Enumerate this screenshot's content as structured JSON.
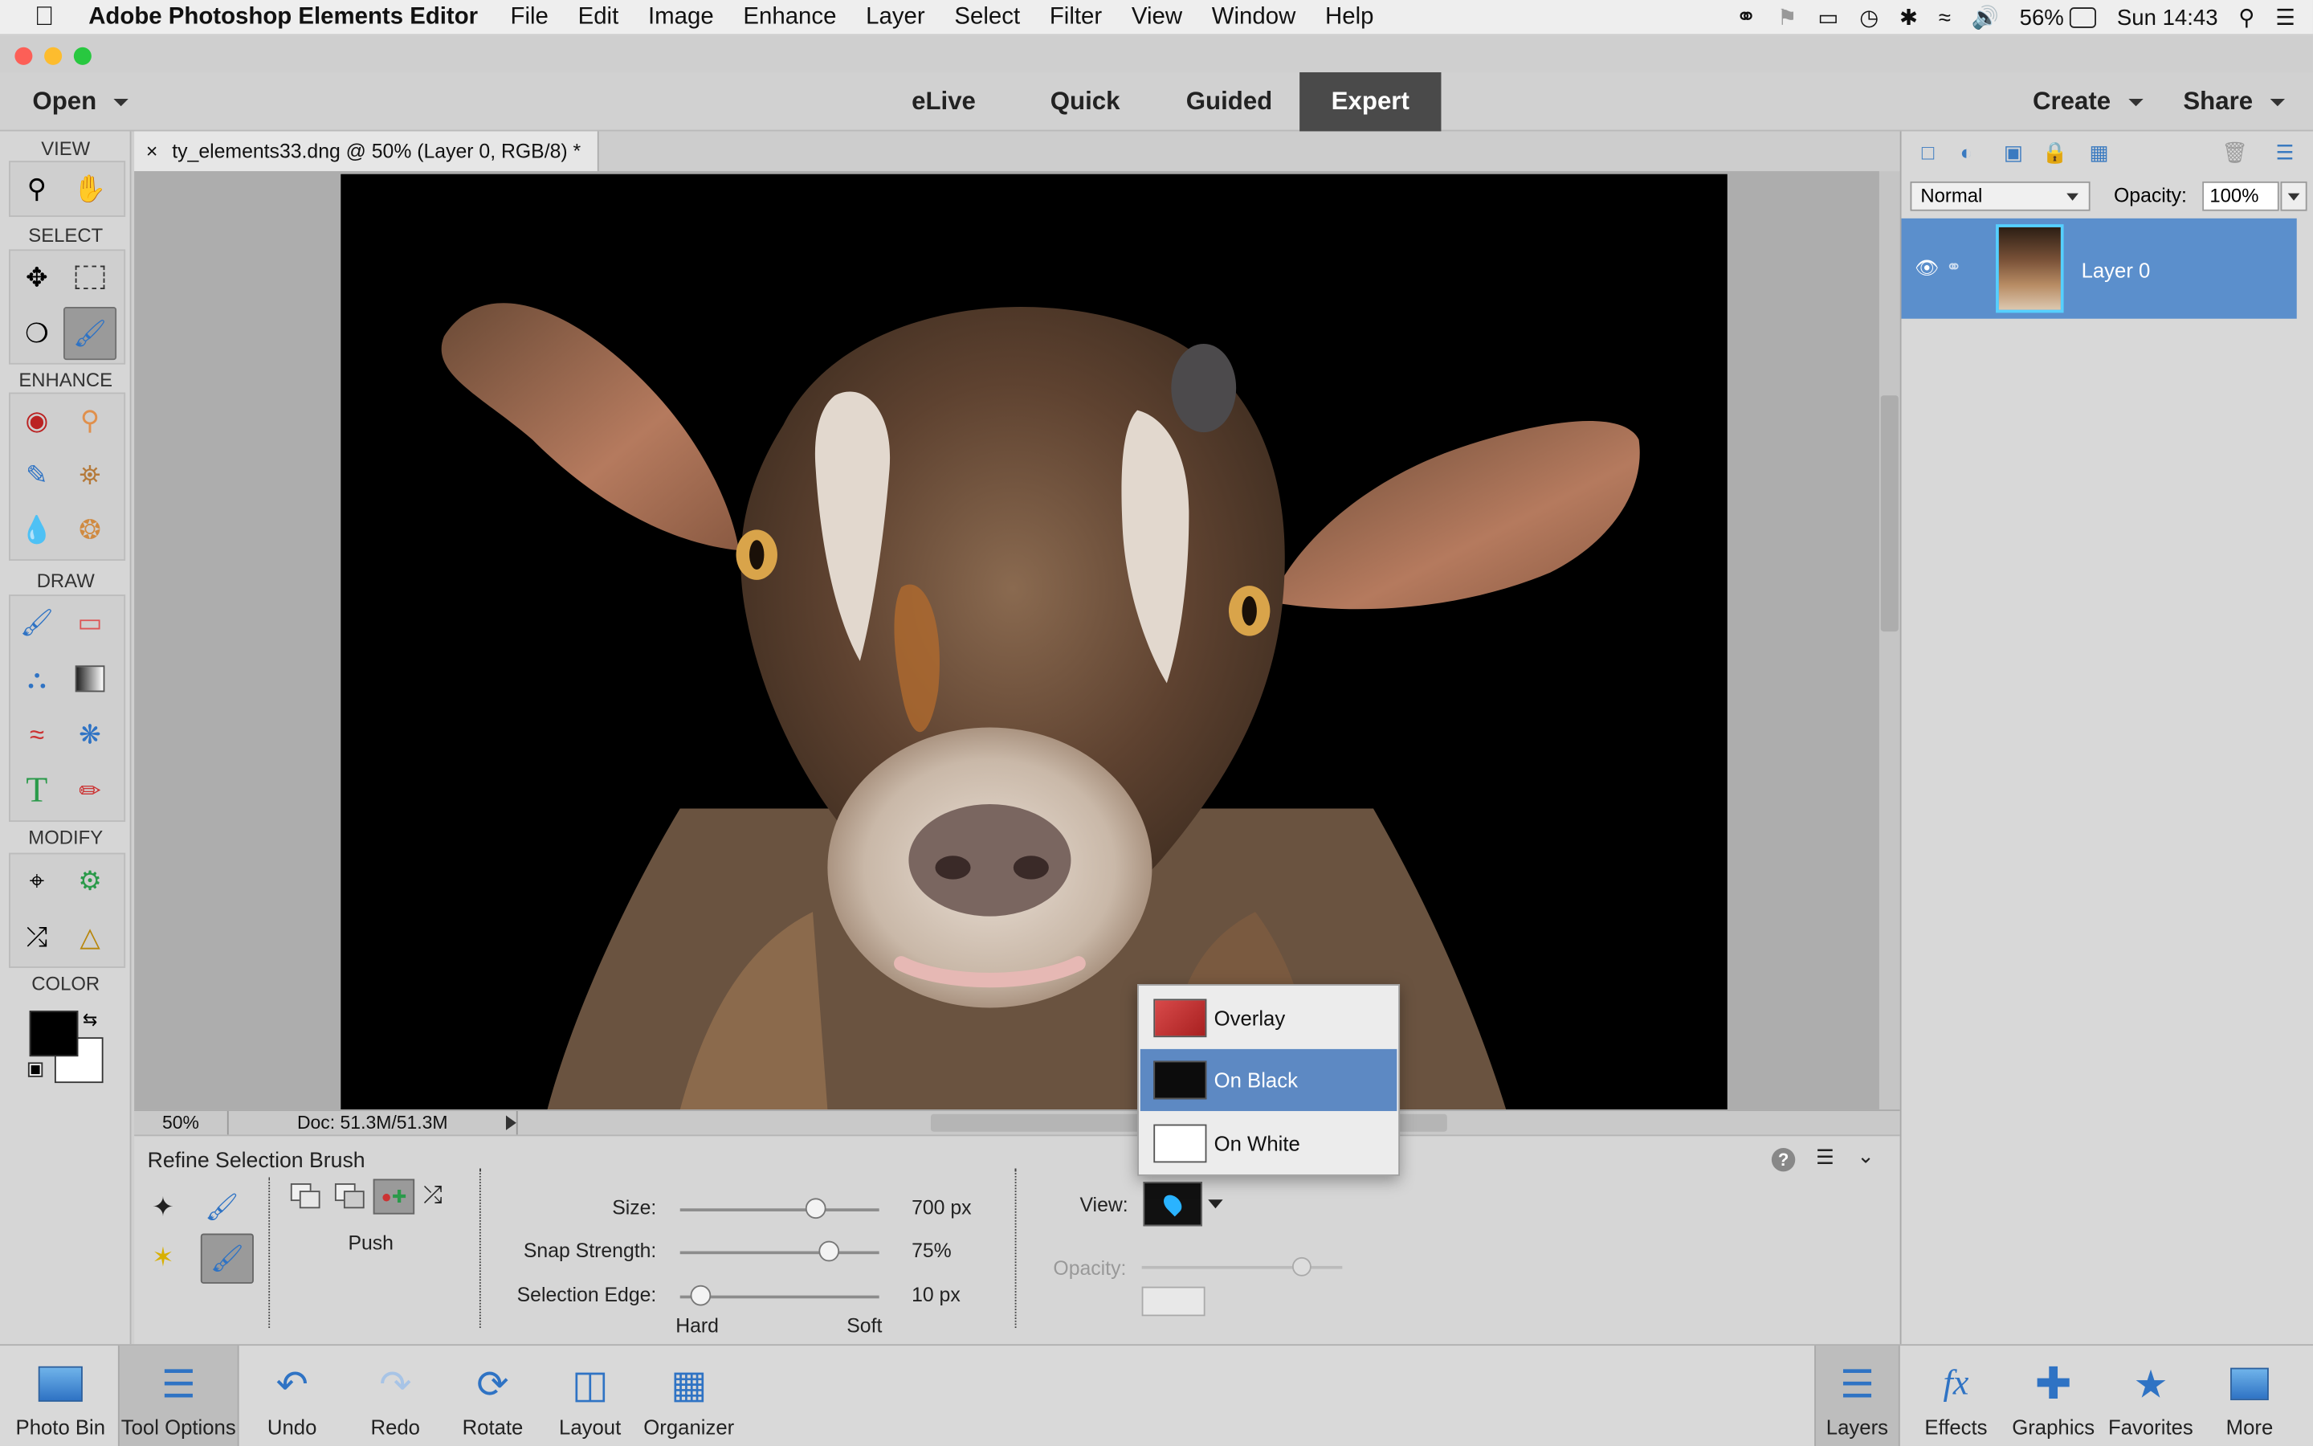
{
  "menubar": {
    "app_name": "Adobe Photoshop Elements Editor",
    "items": [
      "File",
      "Edit",
      "Image",
      "Enhance",
      "Layer",
      "Select",
      "Filter",
      "View",
      "Window",
      "Help"
    ],
    "battery": "56%",
    "clock": "Sun 14:43"
  },
  "modebar": {
    "open_label": "Open",
    "tabs": [
      "eLive",
      "Quick",
      "Guided",
      "Expert"
    ],
    "active_tab": "Expert",
    "create_label": "Create",
    "share_label": "Share"
  },
  "toolbox": {
    "sections": [
      "VIEW",
      "SELECT",
      "ENHANCE",
      "DRAW",
      "MODIFY",
      "COLOR"
    ]
  },
  "document": {
    "tab_title": "ty_elements33.dng @ 50% (Layer 0, RGB/8) *",
    "close_glyph": "×"
  },
  "status": {
    "zoom": "50%",
    "doc_size": "Doc: 51.3M/51.3M"
  },
  "tool_options": {
    "title": "Refine Selection Brush",
    "mode_label": "Push",
    "size_label": "Size:",
    "size_value": "700 px",
    "size_fraction": 0.68,
    "snap_label": "Snap Strength:",
    "snap_value": "75%",
    "snap_fraction": 0.75,
    "edge_label": "Selection Edge:",
    "edge_value": "10 px",
    "edge_fraction": 0.1,
    "hard_label": "Hard",
    "soft_label": "Soft",
    "view_label": "View:",
    "opacity_label": "Opacity:"
  },
  "view_menu": {
    "items": [
      "Overlay",
      "On Black",
      "On White"
    ],
    "selected": "On Black"
  },
  "layers_panel": {
    "blend_mode": "Normal",
    "opacity_label": "Opacity:",
    "opacity_value": "100%",
    "layer_name": "Layer 0"
  },
  "bottombar": {
    "left": [
      "Photo Bin",
      "Tool Options",
      "Undo",
      "Redo",
      "Rotate",
      "Layout",
      "Organizer"
    ],
    "right": [
      "Layers",
      "Effects",
      "Graphics",
      "Favorites",
      "More"
    ],
    "active": [
      "Tool Options",
      "Layers"
    ]
  },
  "colors": {
    "accent": "#5b8fcc",
    "active_tab": "#4a4a4a",
    "icon_blue": "#2f73c4"
  }
}
